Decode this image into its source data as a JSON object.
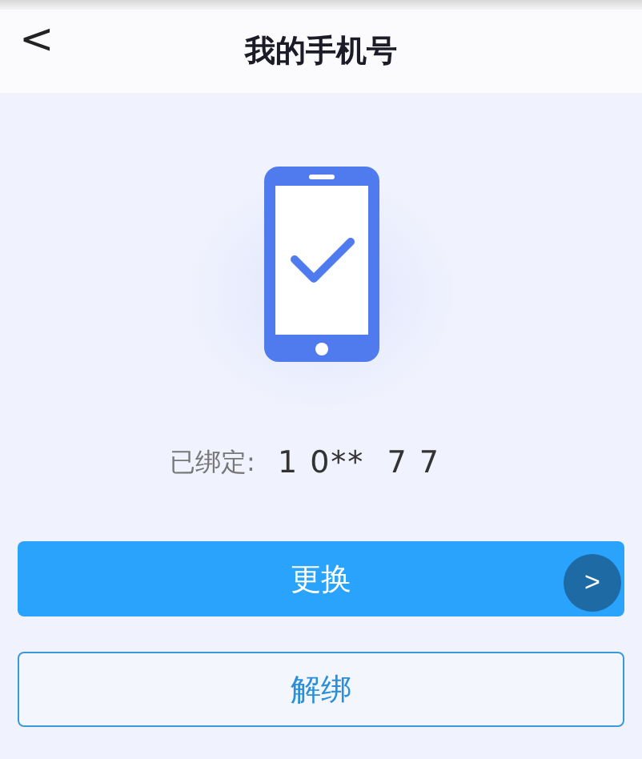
{
  "header": {
    "back": "<",
    "title": "我的手机号"
  },
  "binding": {
    "label": "已绑定:",
    "phone": "1 0**  7 7"
  },
  "buttons": [
    {
      "kind": "primary",
      "label": "更换"
    },
    {
      "kind": "outline",
      "label": "解绑"
    }
  ],
  "floating_button": {
    "label": ">"
  }
}
